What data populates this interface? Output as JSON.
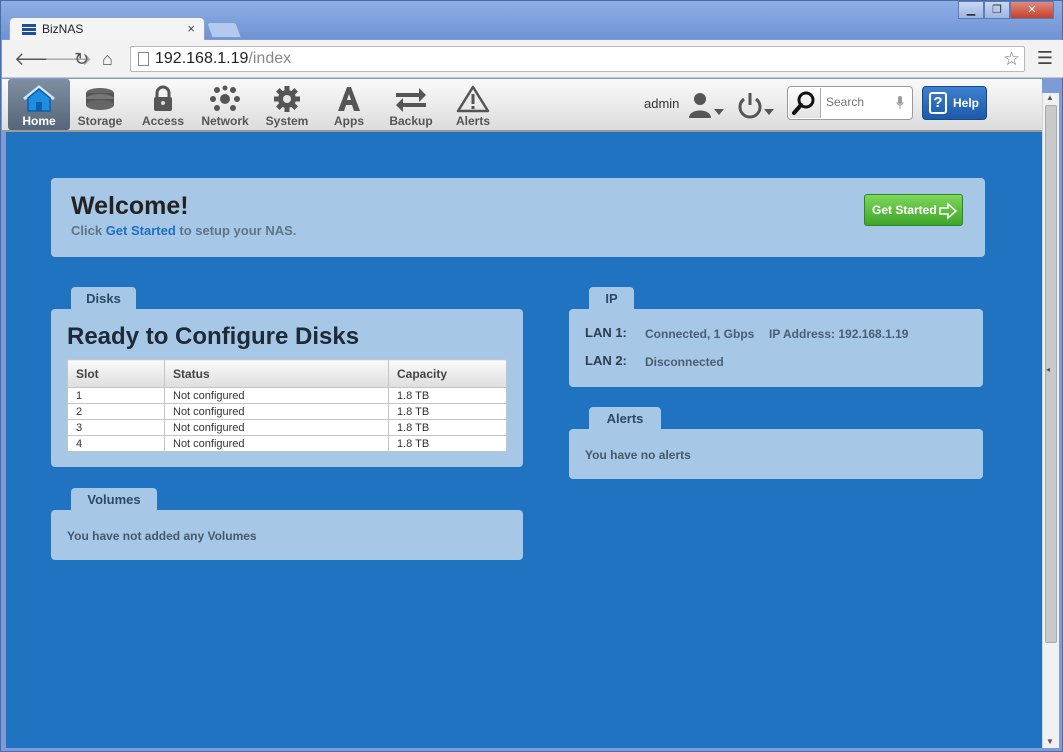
{
  "browser": {
    "tab_title": "BizNAS",
    "tab_close": "×",
    "url_host": "192.168.1.19",
    "url_path": "/index",
    "window_buttons": [
      "▁",
      "❐",
      "✕"
    ]
  },
  "nav": {
    "items": [
      {
        "label": "Home",
        "icon": "home-icon",
        "active": true
      },
      {
        "label": "Storage",
        "icon": "storage-icon"
      },
      {
        "label": "Access",
        "icon": "lock-icon"
      },
      {
        "label": "Network",
        "icon": "network-icon"
      },
      {
        "label": "System",
        "icon": "gear-icon"
      },
      {
        "label": "Apps",
        "icon": "apps-icon"
      },
      {
        "label": "Backup",
        "icon": "backup-icon"
      },
      {
        "label": "Alerts",
        "icon": "alert-icon"
      }
    ],
    "user_label": "admin",
    "search_placeholder": "Search",
    "help_label": "Help",
    "help_glyph": "?"
  },
  "welcome": {
    "title": "Welcome!",
    "text_pre": "Click ",
    "text_link": "Get Started",
    "text_post": " to setup your NAS.",
    "button_label": "Get Started"
  },
  "disks": {
    "tab_label": "Disks",
    "heading": "Ready to Configure Disks",
    "columns": [
      "Slot",
      "Status",
      "Capacity"
    ],
    "rows": [
      [
        "1",
        "Not configured",
        "1.8 TB"
      ],
      [
        "2",
        "Not configured",
        "1.8 TB"
      ],
      [
        "3",
        "Not configured",
        "1.8 TB"
      ],
      [
        "4",
        "Not configured",
        "1.8 TB"
      ]
    ]
  },
  "volumes": {
    "tab_label": "Volumes",
    "message": "You have not added any Volumes"
  },
  "ip": {
    "tab_label": "IP",
    "lan1_label": "LAN 1:",
    "lan1_status": "Connected, 1 Gbps",
    "lan1_ip": "IP Address: 192.168.1.19",
    "lan2_label": "LAN 2:",
    "lan2_status": "Disconnected"
  },
  "alerts": {
    "tab_label": "Alerts",
    "message": "You have no alerts"
  },
  "colors": {
    "content_bg": "#2073c0",
    "panel_bg": "#a7c7e6",
    "accent": "#1e6fc0",
    "button_green": "#3ea52a"
  }
}
